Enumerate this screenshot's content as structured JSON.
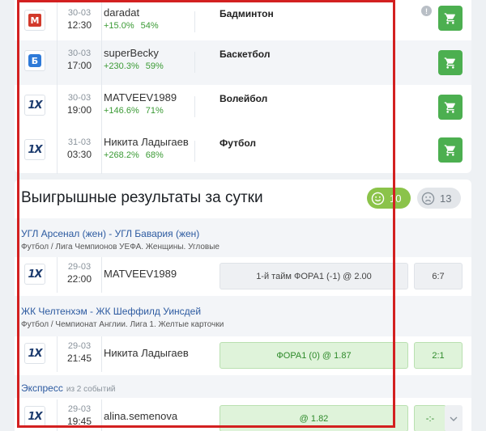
{
  "tips": [
    {
      "bookmaker_icon": "melbet-icon",
      "bookmaker_mark": "M",
      "date": "30-03",
      "time": "12:30",
      "tipster": "daradat",
      "profit": "+15.0%",
      "winrate": "54%",
      "sport": "Бадминтон"
    },
    {
      "bookmaker_icon": "betcity-icon",
      "bookmaker_mark": "Б",
      "date": "30-03",
      "time": "17:00",
      "tipster": "superBecky",
      "profit": "+230.3%",
      "winrate": "59%",
      "sport": "Баскетбол"
    },
    {
      "bookmaker_icon": "1xbet-icon",
      "bookmaker_mark": "1X",
      "date": "30-03",
      "time": "19:00",
      "tipster": "MATVEEV1989",
      "profit": "+146.6%",
      "winrate": "71%",
      "sport": "Волейбол"
    },
    {
      "bookmaker_icon": "1xbet-icon",
      "bookmaker_mark": "1X",
      "date": "31-03",
      "time": "03:30",
      "tipster": "Никита Ладыгаев",
      "profit": "+268.2%",
      "winrate": "68%",
      "sport": "Футбол"
    }
  ],
  "info_icon_glyph": "!",
  "results": {
    "title": "Выигрышные результаты за сутки",
    "good_count": "10",
    "bad_count": "13",
    "events": [
      {
        "title": "УГЛ Арсенал (жен) - УГЛ Бавария (жен)",
        "subtitle": "Футбол / Лига Чемпионов УЕФА. Женщины. Угловые",
        "bookmaker_mark": "1X",
        "date": "29-03",
        "time": "22:00",
        "tipster": "MATVEEV1989",
        "bet": "1-й тайм ФОРА1 (-1) @ 2.00",
        "score": "6:7"
      },
      {
        "title": "ЖК Челтенхэм - ЖК Шеффилд Уинсдей",
        "subtitle": "Футбол / Чемпионат Англии. Лига 1. Желтые карточки",
        "bookmaker_mark": "1X",
        "date": "29-03",
        "time": "21:45",
        "tipster": "Никита Ладыгаев",
        "bet": "ФОРА1 (0) @ 1.87",
        "score": "2:1"
      },
      {
        "title": "Экспресс",
        "extra": "из 2 событий",
        "bookmaker_mark": "1X",
        "date": "29-03",
        "time": "19:45",
        "tipster": "alina.semenova",
        "bet": "@ 1.82",
        "score": "-:-"
      }
    ]
  },
  "colors": {
    "accent_green": "#4caf50",
    "link_blue": "#2c5aa0",
    "highlight_red": "#d32020"
  }
}
